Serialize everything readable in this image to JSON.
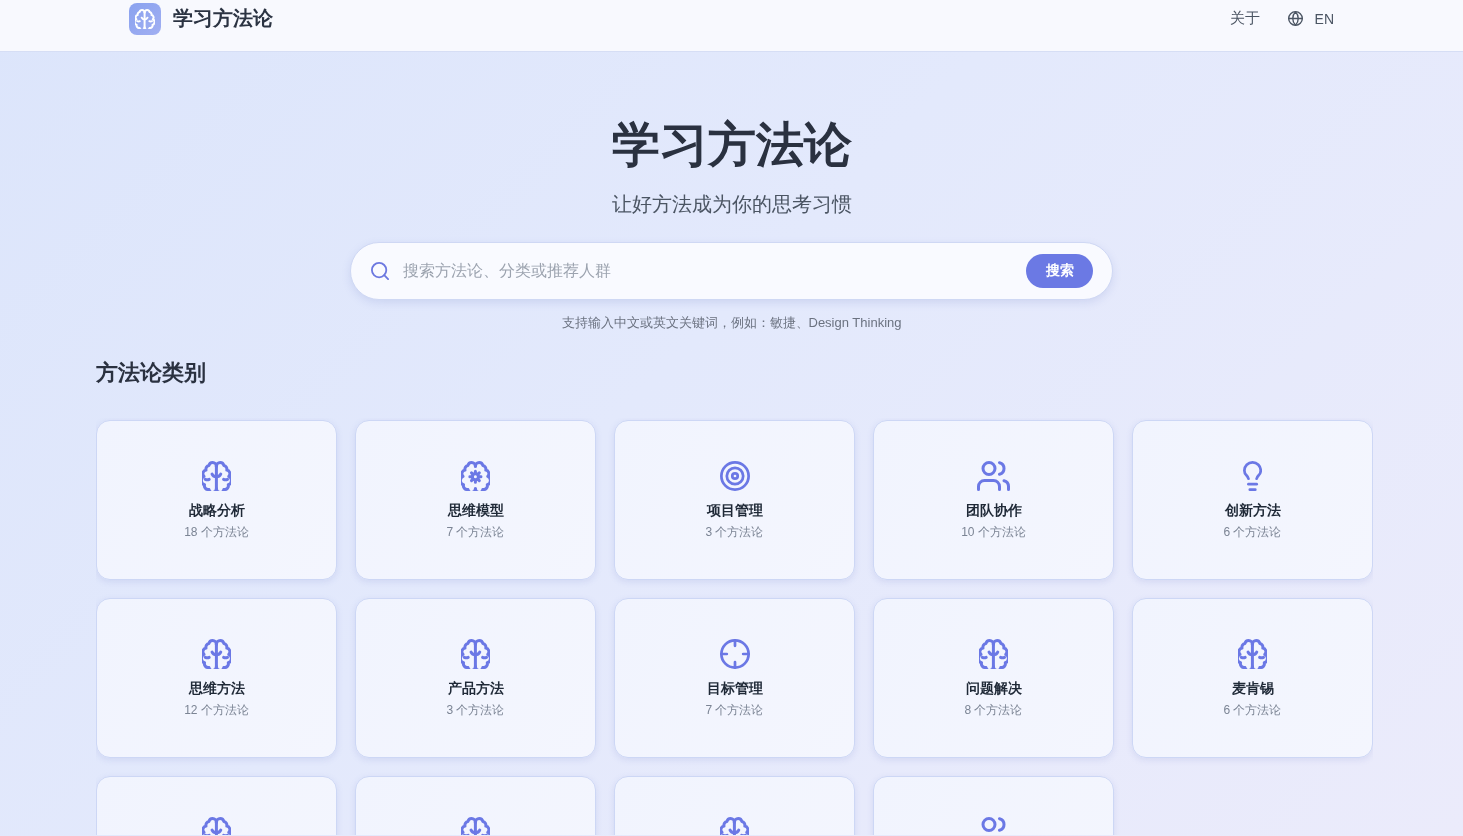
{
  "header": {
    "site_title": "学习方法论",
    "nav": [
      {
        "label": "关于"
      }
    ],
    "language": "EN"
  },
  "hero": {
    "title": "学习方法论",
    "subtitle": "让好方法成为你的思考习惯",
    "search": {
      "placeholder": "搜索方法论、分类或推荐人群",
      "button": "搜索"
    },
    "hint": "支持输入中文或英文关键词，例如：敏捷、Design Thinking"
  },
  "categories": {
    "heading": "方法论类别",
    "items": [
      {
        "kind": "brain",
        "title": "战略分析",
        "count": "18 个方法论"
      },
      {
        "kind": "cog",
        "title": "思维模型",
        "count": "7 个方法论"
      },
      {
        "kind": "target",
        "title": "项目管理",
        "count": "3 个方法论"
      },
      {
        "kind": "users",
        "title": "团队协作",
        "count": "10 个方法论"
      },
      {
        "kind": "bulb",
        "title": "创新方法",
        "count": "6 个方法论"
      },
      {
        "kind": "brain",
        "title": "思维方法",
        "count": "12 个方法论"
      },
      {
        "kind": "brain",
        "title": "产品方法",
        "count": "3 个方法论"
      },
      {
        "kind": "crosshair",
        "title": "目标管理",
        "count": "7 个方法论"
      },
      {
        "kind": "brain",
        "title": "问题解决",
        "count": "8 个方法论"
      },
      {
        "kind": "brain",
        "title": "麦肯锡",
        "count": "6 个方法论"
      },
      {
        "kind": "brain"
      },
      {
        "kind": "brain"
      },
      {
        "kind": "brain"
      },
      {
        "kind": "users"
      }
    ]
  }
}
